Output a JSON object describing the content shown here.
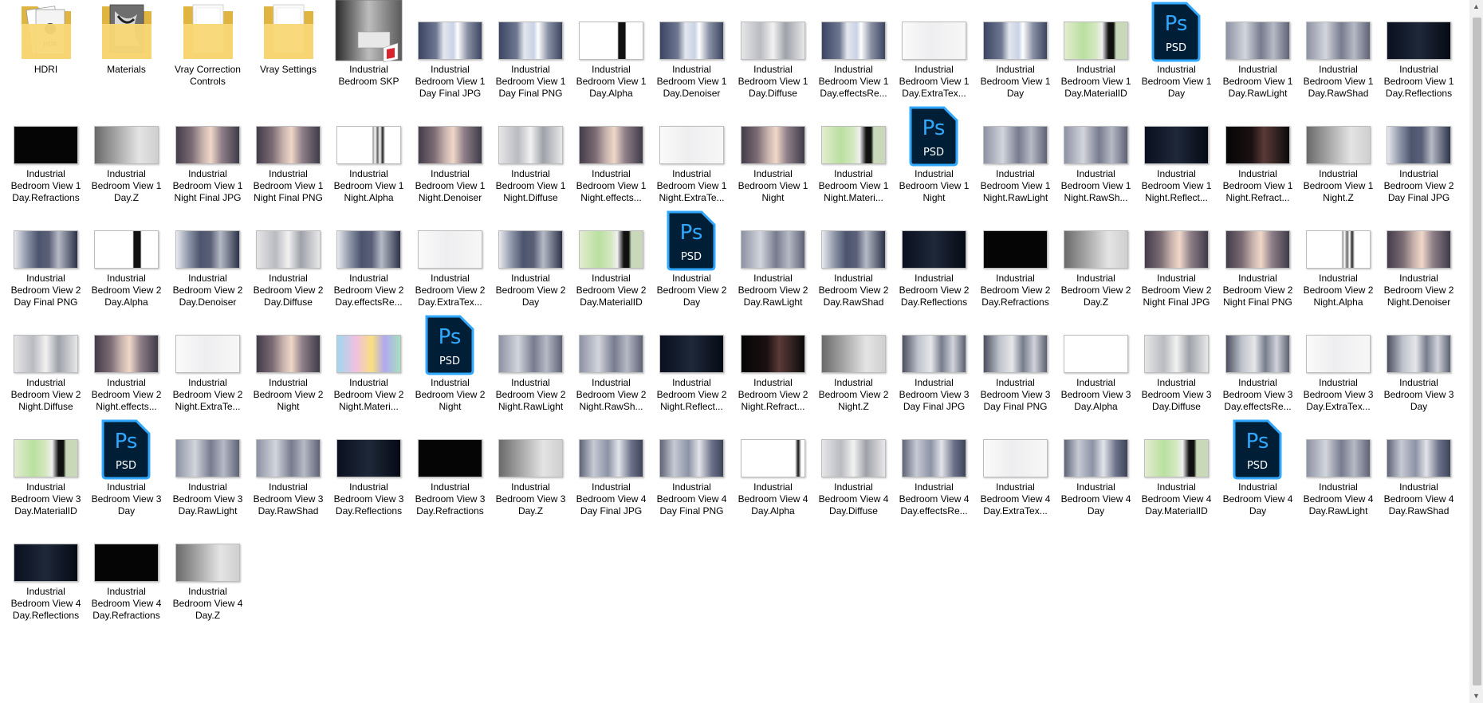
{
  "colors": {
    "psd_dark": "#001e36",
    "psd_blue": "#31a8ff",
    "folder_yellow": "#f8d775",
    "folder_dark": "#e0b440",
    "sketchup_red": "#d9232e"
  },
  "scrollbar": {
    "up_glyph": "▲",
    "down_glyph": "▼"
  },
  "items": [
    {
      "label": "HDRI",
      "icon": "folder-hdri-icon",
      "type": "folder",
      "overlay": "hdri"
    },
    {
      "label": "Materials",
      "icon": "folder-materials-icon",
      "type": "folder",
      "overlay": "materials"
    },
    {
      "label": "Vray Correction Controls",
      "icon": "folder-icon",
      "type": "folder",
      "overlay": "paper"
    },
    {
      "label": "Vray Settings",
      "icon": "folder-icon",
      "type": "folder",
      "overlay": "paper"
    },
    {
      "label": "Industrial Bedroom SKP",
      "icon": "sketchup-file-icon",
      "type": "skp"
    },
    {
      "label": "Industrial Bedroom View 1 Day Final JPG",
      "icon": "image-thumbnail",
      "type": "img",
      "style": "a"
    },
    {
      "label": "Industrial Bedroom View 1 Day Final PNG",
      "icon": "image-thumbnail",
      "type": "img",
      "style": "a"
    },
    {
      "label": "Industrial Bedroom View 1 Day.Alpha",
      "icon": "image-thumbnail",
      "type": "img",
      "style": "alpha"
    },
    {
      "label": "Industrial Bedroom View 1 Day.Denoiser",
      "icon": "image-thumbnail",
      "type": "img",
      "style": "a"
    },
    {
      "label": "Industrial Bedroom View 1 Day.Diffuse",
      "icon": "image-thumbnail",
      "type": "img",
      "style": "diffuse"
    },
    {
      "label": "Industrial Bedroom View 1 Day.effectsRe...",
      "icon": "image-thumbnail",
      "type": "img",
      "style": "a"
    },
    {
      "label": "Industrial Bedroom View 1 Day.ExtraTex...",
      "icon": "image-thumbnail",
      "type": "img",
      "style": "white"
    },
    {
      "label": "Industrial Bedroom View 1 Day",
      "icon": "image-thumbnail",
      "type": "img",
      "style": "a"
    },
    {
      "label": "Industrial Bedroom View 1 Day.MaterialID",
      "icon": "image-thumbnail",
      "type": "img",
      "style": "matid"
    },
    {
      "label": "Industrial Bedroom View 1 Day",
      "icon": "photoshop-psd-icon",
      "type": "psd"
    },
    {
      "label": "Industrial Bedroom View 1 Day.RawLight",
      "icon": "image-thumbnail",
      "type": "img",
      "style": "raw"
    },
    {
      "label": "Industrial Bedroom View 1 Day.RawShad",
      "icon": "image-thumbnail",
      "type": "img",
      "style": "raw"
    },
    {
      "label": "Industrial Bedroom View 1 Day.Reflections",
      "icon": "image-thumbnail",
      "type": "img",
      "style": "dark"
    },
    {
      "label": "Industrial Bedroom View 1 Day.Refractions",
      "icon": "image-thumbnail",
      "type": "img",
      "style": "black"
    },
    {
      "label": "Industrial Bedroom View 1 Day.Z",
      "icon": "image-thumbnail",
      "type": "img",
      "style": "z"
    },
    {
      "label": "Industrial Bedroom View 1 Night Final JPG",
      "icon": "image-thumbnail",
      "type": "img",
      "style": "night"
    },
    {
      "label": "Industrial Bedroom View 1 Night Final PNG",
      "icon": "image-thumbnail",
      "type": "img",
      "style": "night"
    },
    {
      "label": "Industrial Bedroom View 1 Night.Alpha",
      "icon": "image-thumbnail",
      "type": "img",
      "style": "alphan"
    },
    {
      "label": "Industrial Bedroom View 1 Night.Denoiser",
      "icon": "image-thumbnail",
      "type": "img",
      "style": "night"
    },
    {
      "label": "Industrial Bedroom View 1 Night.Diffuse",
      "icon": "image-thumbnail",
      "type": "img",
      "style": "diffuse"
    },
    {
      "label": "Industrial Bedroom View 1 Night.effects...",
      "icon": "image-thumbnail",
      "type": "img",
      "style": "night"
    },
    {
      "label": "Industrial Bedroom View 1 Night.ExtraTe...",
      "icon": "image-thumbnail",
      "type": "img",
      "style": "white"
    },
    {
      "label": "Industrial Bedroom View 1 Night",
      "icon": "image-thumbnail",
      "type": "img",
      "style": "night"
    },
    {
      "label": "Industrial Bedroom View 1 Night.Materi...",
      "icon": "image-thumbnail",
      "type": "img",
      "style": "matid"
    },
    {
      "label": "Industrial Bedroom View 1 Night",
      "icon": "photoshop-psd-icon",
      "type": "psd"
    },
    {
      "label": "Industrial Bedroom View 1 Night.RawLight",
      "icon": "image-thumbnail",
      "type": "img",
      "style": "raw"
    },
    {
      "label": "Industrial Bedroom View 1 Night.RawSh...",
      "icon": "image-thumbnail",
      "type": "img",
      "style": "raw"
    },
    {
      "label": "Industrial Bedroom View 1 Night.Reflect...",
      "icon": "image-thumbnail",
      "type": "img",
      "style": "dark"
    },
    {
      "label": "Industrial Bedroom View 1 Night.Refract...",
      "icon": "image-thumbnail",
      "type": "img",
      "style": "darkred"
    },
    {
      "label": "Industrial Bedroom View 1 Night.Z",
      "icon": "image-thumbnail",
      "type": "img",
      "style": "z"
    },
    {
      "label": "Industrial Bedroom View 2 Day Final JPG",
      "icon": "image-thumbnail",
      "type": "img",
      "style": "b"
    },
    {
      "label": "Industrial Bedroom View 2 Day Final PNG",
      "icon": "image-thumbnail",
      "type": "img",
      "style": "b"
    },
    {
      "label": "Industrial Bedroom View 2 Day.Alpha",
      "icon": "image-thumbnail",
      "type": "img",
      "style": "alpha"
    },
    {
      "label": "Industrial Bedroom View 2 Day.Denoiser",
      "icon": "image-thumbnail",
      "type": "img",
      "style": "b"
    },
    {
      "label": "Industrial Bedroom View 2 Day.Diffuse",
      "icon": "image-thumbnail",
      "type": "img",
      "style": "diffuse"
    },
    {
      "label": "Industrial Bedroom View 2 Day.effectsRe...",
      "icon": "image-thumbnail",
      "type": "img",
      "style": "b"
    },
    {
      "label": "Industrial Bedroom View 2 Day.ExtraTex...",
      "icon": "image-thumbnail",
      "type": "img",
      "style": "white"
    },
    {
      "label": "Industrial Bedroom View 2 Day",
      "icon": "image-thumbnail",
      "type": "img",
      "style": "b"
    },
    {
      "label": "Industrial Bedroom View 2 Day.MaterialID",
      "icon": "image-thumbnail",
      "type": "img",
      "style": "matid"
    },
    {
      "label": "Industrial Bedroom View 2 Day",
      "icon": "photoshop-psd-icon",
      "type": "psd"
    },
    {
      "label": "Industrial Bedroom View 2 Day.RawLight",
      "icon": "image-thumbnail",
      "type": "img",
      "style": "raw"
    },
    {
      "label": "Industrial Bedroom View 2 Day.RawShad",
      "icon": "image-thumbnail",
      "type": "img",
      "style": "b"
    },
    {
      "label": "Industrial Bedroom View 2 Day.Reflections",
      "icon": "image-thumbnail",
      "type": "img",
      "style": "dark"
    },
    {
      "label": "Industrial Bedroom View 2 Day.Refractions",
      "icon": "image-thumbnail",
      "type": "img",
      "style": "black"
    },
    {
      "label": "Industrial Bedroom View 2 Day.Z",
      "icon": "image-thumbnail",
      "type": "img",
      "style": "z"
    },
    {
      "label": "Industrial Bedroom View 2 Night Final JPG",
      "icon": "image-thumbnail",
      "type": "img",
      "style": "night"
    },
    {
      "label": "Industrial Bedroom View 2 Night Final PNG",
      "icon": "image-thumbnail",
      "type": "img",
      "style": "night"
    },
    {
      "label": "Industrial Bedroom View 2 Night.Alpha",
      "icon": "image-thumbnail",
      "type": "img",
      "style": "alphan"
    },
    {
      "label": "Industrial Bedroom View 2 Night.Denoiser",
      "icon": "image-thumbnail",
      "type": "img",
      "style": "night"
    },
    {
      "label": "Industrial Bedroom View 2 Night.Diffuse",
      "icon": "image-thumbnail",
      "type": "img",
      "style": "diffuse"
    },
    {
      "label": "Industrial Bedroom View 2 Night.effects...",
      "icon": "image-thumbnail",
      "type": "img",
      "style": "night"
    },
    {
      "label": "Industrial Bedroom View 2 Night.ExtraTe...",
      "icon": "image-thumbnail",
      "type": "img",
      "style": "white"
    },
    {
      "label": "Industrial Bedroom View 2 Night",
      "icon": "image-thumbnail",
      "type": "img",
      "style": "night"
    },
    {
      "label": "Industrial Bedroom View 2 Night.Materi...",
      "icon": "image-thumbnail",
      "type": "img",
      "style": "matid2"
    },
    {
      "label": "Industrial Bedroom View 2 Night",
      "icon": "photoshop-psd-icon",
      "type": "psd"
    },
    {
      "label": "Industrial Bedroom View 2 Night.RawLight",
      "icon": "image-thumbnail",
      "type": "img",
      "style": "raw"
    },
    {
      "label": "Industrial Bedroom View 2 Night.RawSh...",
      "icon": "image-thumbnail",
      "type": "img",
      "style": "raw"
    },
    {
      "label": "Industrial Bedroom View 2 Night.Reflect...",
      "icon": "image-thumbnail",
      "type": "img",
      "style": "dark"
    },
    {
      "label": "Industrial Bedroom View 2 Night.Refract...",
      "icon": "image-thumbnail",
      "type": "img",
      "style": "darkred"
    },
    {
      "label": "Industrial Bedroom View 2 Night.Z",
      "icon": "image-thumbnail",
      "type": "img",
      "style": "z"
    },
    {
      "label": "Industrial Bedroom View 3 Day Final JPG",
      "icon": "image-thumbnail",
      "type": "img",
      "style": "c"
    },
    {
      "label": "Industrial Bedroom View 3 Day Final PNG",
      "icon": "image-thumbnail",
      "type": "img",
      "style": "c"
    },
    {
      "label": "Industrial Bedroom View 3 Day.Alpha",
      "icon": "image-thumbnail",
      "type": "img",
      "style": "whiteplain"
    },
    {
      "label": "Industrial Bedroom View 3 Day.Diffuse",
      "icon": "image-thumbnail",
      "type": "img",
      "style": "diffuse"
    },
    {
      "label": "Industrial Bedroom View 3 Day.effectsRe...",
      "icon": "image-thumbnail",
      "type": "img",
      "style": "c"
    },
    {
      "label": "Industrial Bedroom View 3 Day.ExtraTex...",
      "icon": "image-thumbnail",
      "type": "img",
      "style": "white"
    },
    {
      "label": "Industrial Bedroom View 3 Day",
      "icon": "image-thumbnail",
      "type": "img",
      "style": "c"
    },
    {
      "label": "Industrial Bedroom View 3 Day.MaterialID",
      "icon": "image-thumbnail",
      "type": "img",
      "style": "matid"
    },
    {
      "label": "Industrial Bedroom View 3 Day",
      "icon": "photoshop-psd-icon",
      "type": "psd"
    },
    {
      "label": "Industrial Bedroom View 3 Day.RawLight",
      "icon": "image-thumbnail",
      "type": "img",
      "style": "raw"
    },
    {
      "label": "Industrial Bedroom View 3 Day.RawShad",
      "icon": "image-thumbnail",
      "type": "img",
      "style": "raw"
    },
    {
      "label": "Industrial Bedroom View 3 Day.Reflections",
      "icon": "image-thumbnail",
      "type": "img",
      "style": "dark"
    },
    {
      "label": "Industrial Bedroom View 3 Day.Refractions",
      "icon": "image-thumbnail",
      "type": "img",
      "style": "black"
    },
    {
      "label": "Industrial Bedroom View 3 Day.Z",
      "icon": "image-thumbnail",
      "type": "img",
      "style": "z"
    },
    {
      "label": "Industrial Bedroom View 4 Day Final JPG",
      "icon": "image-thumbnail",
      "type": "img",
      "style": "d"
    },
    {
      "label": "Industrial Bedroom View 4 Day Final PNG",
      "icon": "image-thumbnail",
      "type": "img",
      "style": "d"
    },
    {
      "label": "Industrial Bedroom View 4 Day.Alpha",
      "icon": "image-thumbnail",
      "type": "img",
      "style": "alpha4"
    },
    {
      "label": "Industrial Bedroom View 4 Day.Diffuse",
      "icon": "image-thumbnail",
      "type": "img",
      "style": "diffuse"
    },
    {
      "label": "Industrial Bedroom View 4 Day.effectsRe...",
      "icon": "image-thumbnail",
      "type": "img",
      "style": "d"
    },
    {
      "label": "Industrial Bedroom View 4 Day.ExtraTex...",
      "icon": "image-thumbnail",
      "type": "img",
      "style": "white"
    },
    {
      "label": "Industrial Bedroom View 4 Day",
      "icon": "image-thumbnail",
      "type": "img",
      "style": "d"
    },
    {
      "label": "Industrial Bedroom View 4 Day.MaterialID",
      "icon": "image-thumbnail",
      "type": "img",
      "style": "matid"
    },
    {
      "label": "Industrial Bedroom View 4 Day",
      "icon": "photoshop-psd-icon",
      "type": "psd"
    },
    {
      "label": "Industrial Bedroom View 4 Day.RawLight",
      "icon": "image-thumbnail",
      "type": "img",
      "style": "raw"
    },
    {
      "label": "Industrial Bedroom View 4 Day.RawShad",
      "icon": "image-thumbnail",
      "type": "img",
      "style": "d"
    },
    {
      "label": "Industrial Bedroom View 4 Day.Reflections",
      "icon": "image-thumbnail",
      "type": "img",
      "style": "dark"
    },
    {
      "label": "Industrial Bedroom View 4 Day.Refractions",
      "icon": "image-thumbnail",
      "type": "img",
      "style": "black"
    },
    {
      "label": "Industrial Bedroom View 4 Day.Z",
      "icon": "image-thumbnail",
      "type": "img",
      "style": "z"
    }
  ]
}
